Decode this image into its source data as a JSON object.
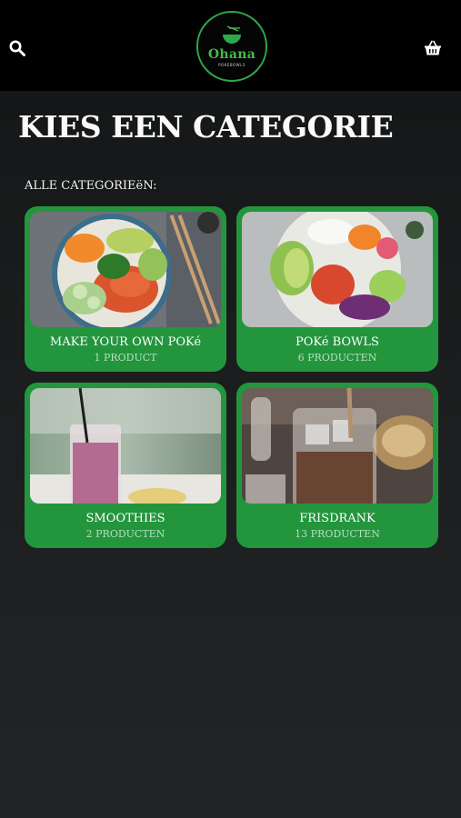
{
  "header": {
    "logo": {
      "name": "Ohana",
      "subtitle": "POKEBOWLS"
    },
    "icons": {
      "search": "search-icon",
      "cart": "basket-icon"
    }
  },
  "page": {
    "title": "KIES EEN CATEGORIE",
    "section_label": "ALLE CATEGORIEëN:"
  },
  "categories": [
    {
      "name": "MAKE YOUR OWN POKé",
      "count": "1 PRODUCT"
    },
    {
      "name": "POKé BOWLS",
      "count": "6 PRODUCTEN"
    },
    {
      "name": "SMOOTHIES",
      "count": "2 PRODUCTEN"
    },
    {
      "name": "FRISDRANK",
      "count": "13 PRODUCTEN"
    }
  ],
  "colors": {
    "accent": "#23953d",
    "header_bg": "#000000",
    "page_bg": "#1a1c1d"
  }
}
